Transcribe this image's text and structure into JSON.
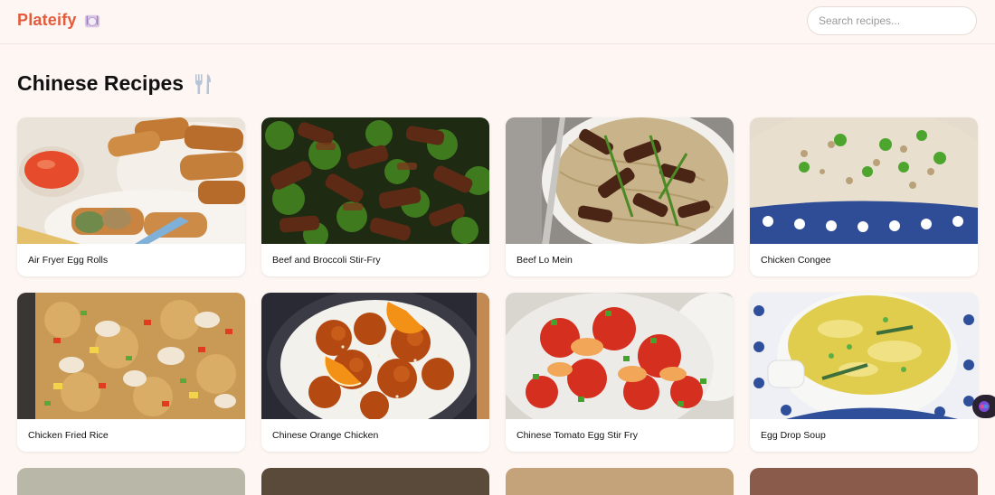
{
  "header": {
    "brand": "Plateify",
    "brand_icon": "plate-icon",
    "search_placeholder": "Search recipes..."
  },
  "page": {
    "title": "Chinese Recipes",
    "title_icon": "utensils-icon"
  },
  "recipes": [
    {
      "name": "Air Fryer Egg Rolls"
    },
    {
      "name": "Beef and Broccoli Stir-Fry"
    },
    {
      "name": "Beef Lo Mein"
    },
    {
      "name": "Chicken Congee"
    },
    {
      "name": "Chicken Fried Rice"
    },
    {
      "name": "Chinese Orange Chicken"
    },
    {
      "name": "Chinese Tomato Egg Stir Fry"
    },
    {
      "name": "Egg Drop Soup"
    }
  ],
  "colors": {
    "brand": "#e45a3c",
    "background": "#fdf6f2",
    "card": "#ffffff"
  }
}
